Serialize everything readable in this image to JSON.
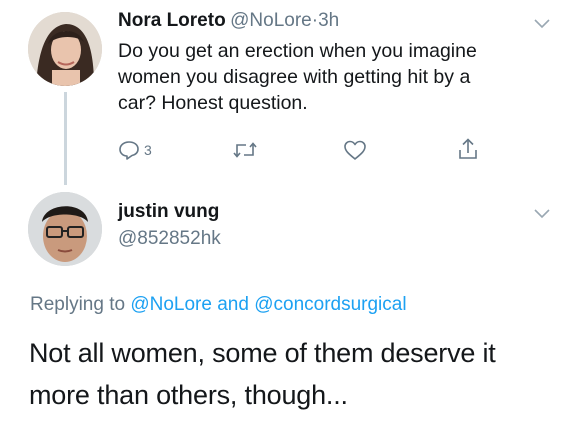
{
  "tweet1": {
    "display_name": "Nora Loreto",
    "handle": "@NoLore",
    "separator": "·",
    "time": "3h",
    "text_lines": [
      "Do you get an erection when you imagine",
      "women you disagree with getting hit by a",
      "car? Honest question."
    ],
    "reply_count": "3"
  },
  "tweet2": {
    "display_name": "justin vung",
    "handle": "@852852hk",
    "replying_prefix": "Replying to",
    "replying_to_1": "@NoLore",
    "replying_and": "and",
    "replying_to_2": "@concordsurgical",
    "text_lines": [
      "Not all women, some of them deserve it",
      "more than others, though..."
    ]
  },
  "colors": {
    "link": "#1da1f2",
    "secondary_text": "#657786",
    "thread_line": "#ccd6dd"
  },
  "icons": {
    "reply": "reply-icon",
    "retweet": "retweet-icon",
    "like": "heart-icon",
    "share": "share-icon",
    "menu": "chevron-down-icon"
  }
}
